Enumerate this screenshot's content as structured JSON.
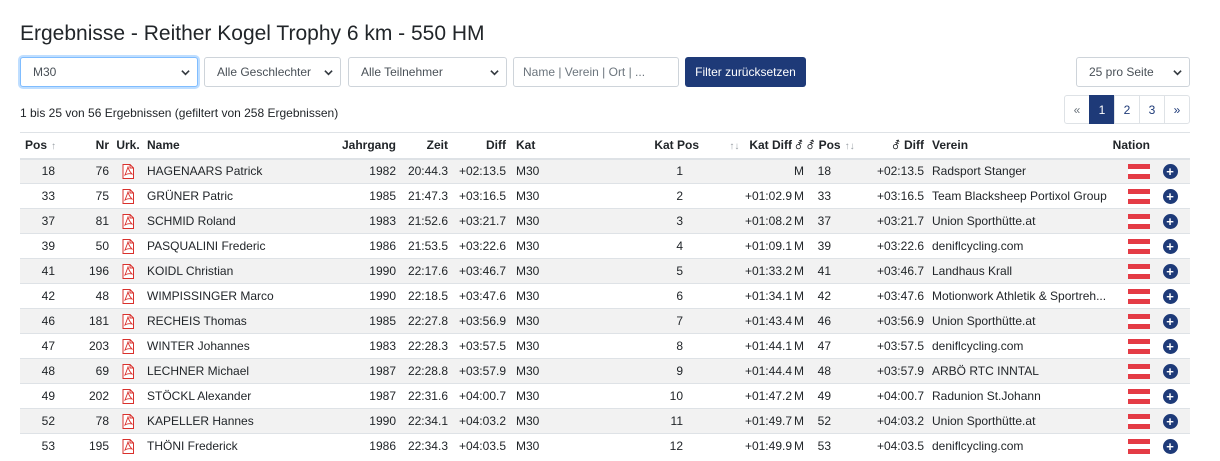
{
  "page_title": "Ergebnisse - Reither Kogel Trophy 6 km - 550 HM",
  "filters": {
    "category_selected": "M30",
    "gender_selected": "Alle Geschlechter",
    "participant_selected": "Alle Teilnehmer",
    "search_placeholder": "Name | Verein | Ort | ...",
    "reset_label": "Filter zurücksetzen",
    "per_page_selected": "25 pro Seite"
  },
  "info_text": "1 bis 25 von 56 Ergebnissen (gefiltert von 258 Ergebnissen)",
  "pagination": {
    "prev": "«",
    "pages": [
      "1",
      "2",
      "3"
    ],
    "active": "1",
    "next": "»"
  },
  "table": {
    "columns": {
      "pos": "Pos",
      "nr": "Nr",
      "urk": "Urk.",
      "name": "Name",
      "jahrgang": "Jahrgang",
      "zeit": "Zeit",
      "diff": "Diff",
      "kat": "Kat",
      "kat_pos": "Kat Pos",
      "kat_diff": "Kat Diff",
      "g_pos": "Pos",
      "g_diff": "Diff",
      "verein": "Verein",
      "nation": "Nation"
    },
    "rows": [
      {
        "pos": "18",
        "nr": "76",
        "name": "HAGENAARS Patrick",
        "jahrgang": "1982",
        "zeit": "20:44.3",
        "diff": "+02:13.5",
        "kat": "M30",
        "kat_pos": "1",
        "kat_diff": "",
        "g": "M",
        "g_pos": "18",
        "g_diff": "+02:13.5",
        "verein": "Radsport Stanger"
      },
      {
        "pos": "33",
        "nr": "75",
        "name": "GRÜNER Patric",
        "jahrgang": "1985",
        "zeit": "21:47.3",
        "diff": "+03:16.5",
        "kat": "M30",
        "kat_pos": "2",
        "kat_diff": "+01:02.9",
        "g": "M",
        "g_pos": "33",
        "g_diff": "+03:16.5",
        "verein": "Team Blacksheep Portixol Group"
      },
      {
        "pos": "37",
        "nr": "81",
        "name": "SCHMID Roland",
        "jahrgang": "1983",
        "zeit": "21:52.6",
        "diff": "+03:21.7",
        "kat": "M30",
        "kat_pos": "3",
        "kat_diff": "+01:08.2",
        "g": "M",
        "g_pos": "37",
        "g_diff": "+03:21.7",
        "verein": "Union Sporthütte.at"
      },
      {
        "pos": "39",
        "nr": "50",
        "name": "PASQUALINI Frederic",
        "jahrgang": "1986",
        "zeit": "21:53.5",
        "diff": "+03:22.6",
        "kat": "M30",
        "kat_pos": "4",
        "kat_diff": "+01:09.1",
        "g": "M",
        "g_pos": "39",
        "g_diff": "+03:22.6",
        "verein": "deniflcycling.com"
      },
      {
        "pos": "41",
        "nr": "196",
        "name": "KOIDL Christian",
        "jahrgang": "1990",
        "zeit": "22:17.6",
        "diff": "+03:46.7",
        "kat": "M30",
        "kat_pos": "5",
        "kat_diff": "+01:33.2",
        "g": "M",
        "g_pos": "41",
        "g_diff": "+03:46.7",
        "verein": "Landhaus Krall"
      },
      {
        "pos": "42",
        "nr": "48",
        "name": "WIMPISSINGER Marco",
        "jahrgang": "1990",
        "zeit": "22:18.5",
        "diff": "+03:47.6",
        "kat": "M30",
        "kat_pos": "6",
        "kat_diff": "+01:34.1",
        "g": "M",
        "g_pos": "42",
        "g_diff": "+03:47.6",
        "verein": "Motionwork Athletik & Sportreh..."
      },
      {
        "pos": "46",
        "nr": "181",
        "name": "RECHEIS Thomas",
        "jahrgang": "1985",
        "zeit": "22:27.8",
        "diff": "+03:56.9",
        "kat": "M30",
        "kat_pos": "7",
        "kat_diff": "+01:43.4",
        "g": "M",
        "g_pos": "46",
        "g_diff": "+03:56.9",
        "verein": "Union Sporthütte.at"
      },
      {
        "pos": "47",
        "nr": "203",
        "name": "WINTER Johannes",
        "jahrgang": "1983",
        "zeit": "22:28.3",
        "diff": "+03:57.5",
        "kat": "M30",
        "kat_pos": "8",
        "kat_diff": "+01:44.1",
        "g": "M",
        "g_pos": "47",
        "g_diff": "+03:57.5",
        "verein": "deniflcycling.com"
      },
      {
        "pos": "48",
        "nr": "69",
        "name": "LECHNER Michael",
        "jahrgang": "1987",
        "zeit": "22:28.8",
        "diff": "+03:57.9",
        "kat": "M30",
        "kat_pos": "9",
        "kat_diff": "+01:44.4",
        "g": "M",
        "g_pos": "48",
        "g_diff": "+03:57.9",
        "verein": "ARBÖ RTC INNTAL"
      },
      {
        "pos": "49",
        "nr": "202",
        "name": "STÖCKL Alexander",
        "jahrgang": "1987",
        "zeit": "22:31.6",
        "diff": "+04:00.7",
        "kat": "M30",
        "kat_pos": "10",
        "kat_diff": "+01:47.2",
        "g": "M",
        "g_pos": "49",
        "g_diff": "+04:00.7",
        "verein": "Radunion St.Johann"
      },
      {
        "pos": "52",
        "nr": "78",
        "name": "KAPELLER Hannes",
        "jahrgang": "1990",
        "zeit": "22:34.1",
        "diff": "+04:03.2",
        "kat": "M30",
        "kat_pos": "11",
        "kat_diff": "+01:49.7",
        "g": "M",
        "g_pos": "52",
        "g_diff": "+04:03.2",
        "verein": "Union Sporthütte.at"
      },
      {
        "pos": "53",
        "nr": "195",
        "name": "THÖNI Frederick",
        "jahrgang": "1986",
        "zeit": "22:34.3",
        "diff": "+04:03.5",
        "kat": "M30",
        "kat_pos": "12",
        "kat_diff": "+01:49.9",
        "g": "M",
        "g_pos": "53",
        "g_diff": "+04:03.5",
        "verein": "deniflcycling.com"
      }
    ]
  }
}
